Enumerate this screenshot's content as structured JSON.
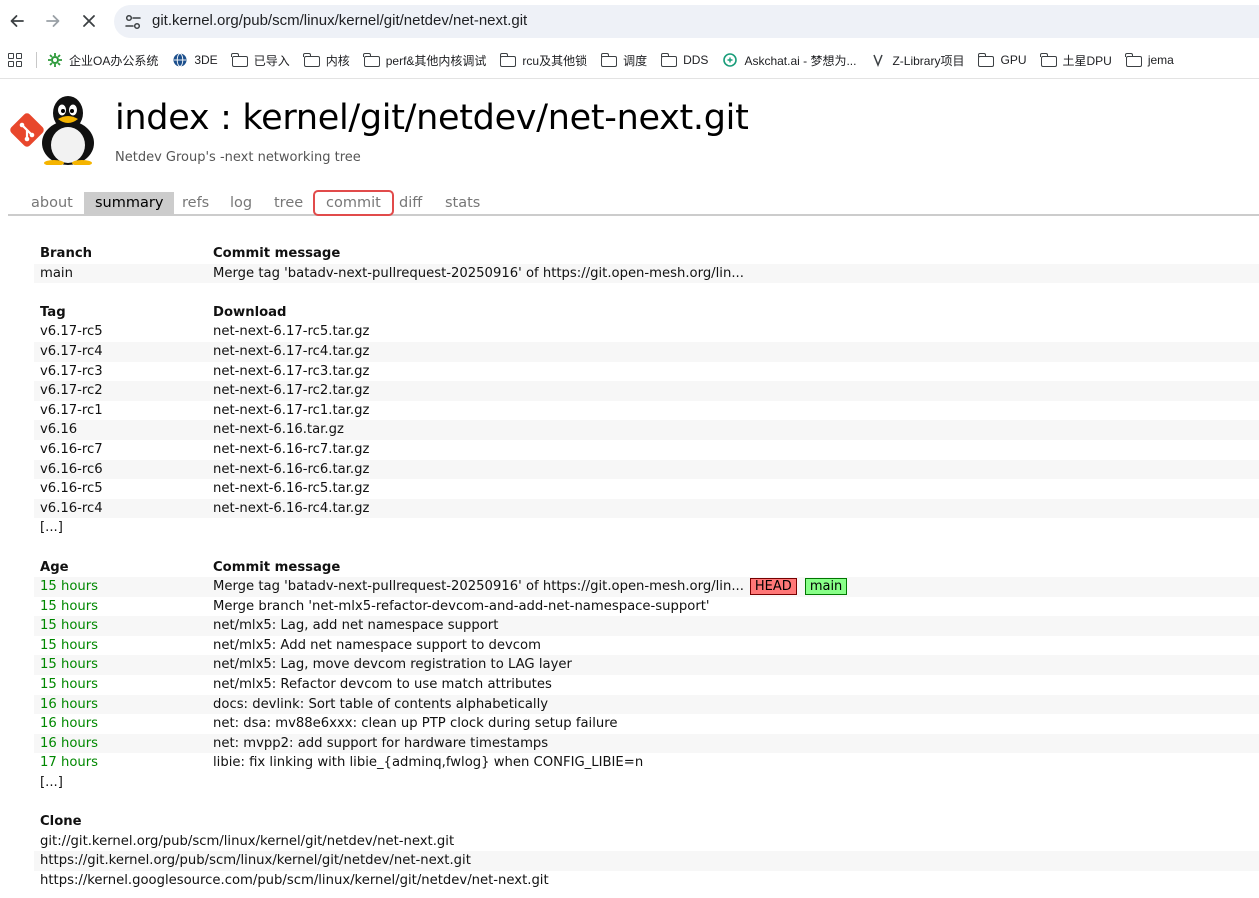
{
  "browser": {
    "url": "git.kernel.org/pub/scm/linux/kernel/git/netdev/net-next.git",
    "bookmarks": [
      {
        "label": "企业OA办公系统",
        "icon": "gear-green-icon"
      },
      {
        "label": "3DE",
        "icon": "globe-icon"
      },
      {
        "label": "已导入",
        "icon": "folder-icon"
      },
      {
        "label": "内核",
        "icon": "folder-icon"
      },
      {
        "label": "perf&其他内核调试",
        "icon": "folder-icon"
      },
      {
        "label": "rcu及其他锁",
        "icon": "folder-icon"
      },
      {
        "label": "调度",
        "icon": "folder-icon"
      },
      {
        "label": "DDS",
        "icon": "folder-icon"
      },
      {
        "label": "Askchat.ai - 梦想为...",
        "icon": "chat-icon"
      },
      {
        "label": "Z-Library项目",
        "icon": "zlib-icon"
      },
      {
        "label": "GPU",
        "icon": "folder-icon"
      },
      {
        "label": "土星DPU",
        "icon": "folder-icon"
      },
      {
        "label": "jema",
        "icon": "folder-icon"
      }
    ]
  },
  "repo": {
    "title": "index : kernel/git/netdev/net-next.git",
    "description": "Netdev Group's -next networking tree"
  },
  "tabs": [
    {
      "label": "about",
      "active": false
    },
    {
      "label": "summary",
      "active": true
    },
    {
      "label": "refs",
      "active": false
    },
    {
      "label": "log",
      "active": false
    },
    {
      "label": "tree",
      "active": false
    },
    {
      "label": "commit",
      "active": false,
      "highlighted": true
    },
    {
      "label": "diff",
      "active": false
    },
    {
      "label": "stats",
      "active": false
    }
  ],
  "branches": {
    "headers": [
      "Branch",
      "Commit message"
    ],
    "rows": [
      {
        "name": "main",
        "message": "Merge tag 'batadv-next-pullrequest-20250916' of https://git.open-mesh.org/lin..."
      }
    ]
  },
  "tags": {
    "headers": [
      "Tag",
      "Download"
    ],
    "rows": [
      {
        "name": "v6.17-rc5",
        "download": "net-next-6.17-rc5.tar.gz"
      },
      {
        "name": "v6.17-rc4",
        "download": "net-next-6.17-rc4.tar.gz"
      },
      {
        "name": "v6.17-rc3",
        "download": "net-next-6.17-rc3.tar.gz"
      },
      {
        "name": "v6.17-rc2",
        "download": "net-next-6.17-rc2.tar.gz"
      },
      {
        "name": "v6.17-rc1",
        "download": "net-next-6.17-rc1.tar.gz"
      },
      {
        "name": "v6.16",
        "download": "net-next-6.16.tar.gz"
      },
      {
        "name": "v6.16-rc7",
        "download": "net-next-6.16-rc7.tar.gz"
      },
      {
        "name": "v6.16-rc6",
        "download": "net-next-6.16-rc6.tar.gz"
      },
      {
        "name": "v6.16-rc5",
        "download": "net-next-6.16-rc5.tar.gz"
      },
      {
        "name": "v6.16-rc4",
        "download": "net-next-6.16-rc4.tar.gz"
      }
    ],
    "more": "[...]"
  },
  "commits": {
    "headers": [
      "Age",
      "Commit message"
    ],
    "rows": [
      {
        "age": "15 hours",
        "message": "Merge tag 'batadv-next-pullrequest-20250916' of https://git.open-mesh.org/lin...",
        "decorations": [
          "HEAD",
          "main"
        ]
      },
      {
        "age": "15 hours",
        "message": "Merge branch 'net-mlx5-refactor-devcom-and-add-net-namespace-support'"
      },
      {
        "age": "15 hours",
        "message": "net/mlx5: Lag, add net namespace support"
      },
      {
        "age": "15 hours",
        "message": "net/mlx5: Add net namespace support to devcom"
      },
      {
        "age": "15 hours",
        "message": "net/mlx5: Lag, move devcom registration to LAG layer"
      },
      {
        "age": "15 hours",
        "message": "net/mlx5: Refactor devcom to use match attributes"
      },
      {
        "age": "16 hours",
        "message": "docs: devlink: Sort table of contents alphabetically"
      },
      {
        "age": "16 hours",
        "message": "net: dsa: mv88e6xxx: clean up PTP clock during setup failure"
      },
      {
        "age": "16 hours",
        "message": "net: mvpp2: add support for hardware timestamps"
      },
      {
        "age": "17 hours",
        "message": "libie: fix linking with libie_{adminq,fwlog} when CONFIG_LIBIE=n"
      }
    ],
    "more": "[...]"
  },
  "clone": {
    "header": "Clone",
    "urls": [
      "git://git.kernel.org/pub/scm/linux/kernel/git/netdev/net-next.git",
      "https://git.kernel.org/pub/scm/linux/kernel/git/netdev/net-next.git",
      "https://kernel.googlesource.com/pub/scm/linux/kernel/git/netdev/net-next.git"
    ]
  }
}
